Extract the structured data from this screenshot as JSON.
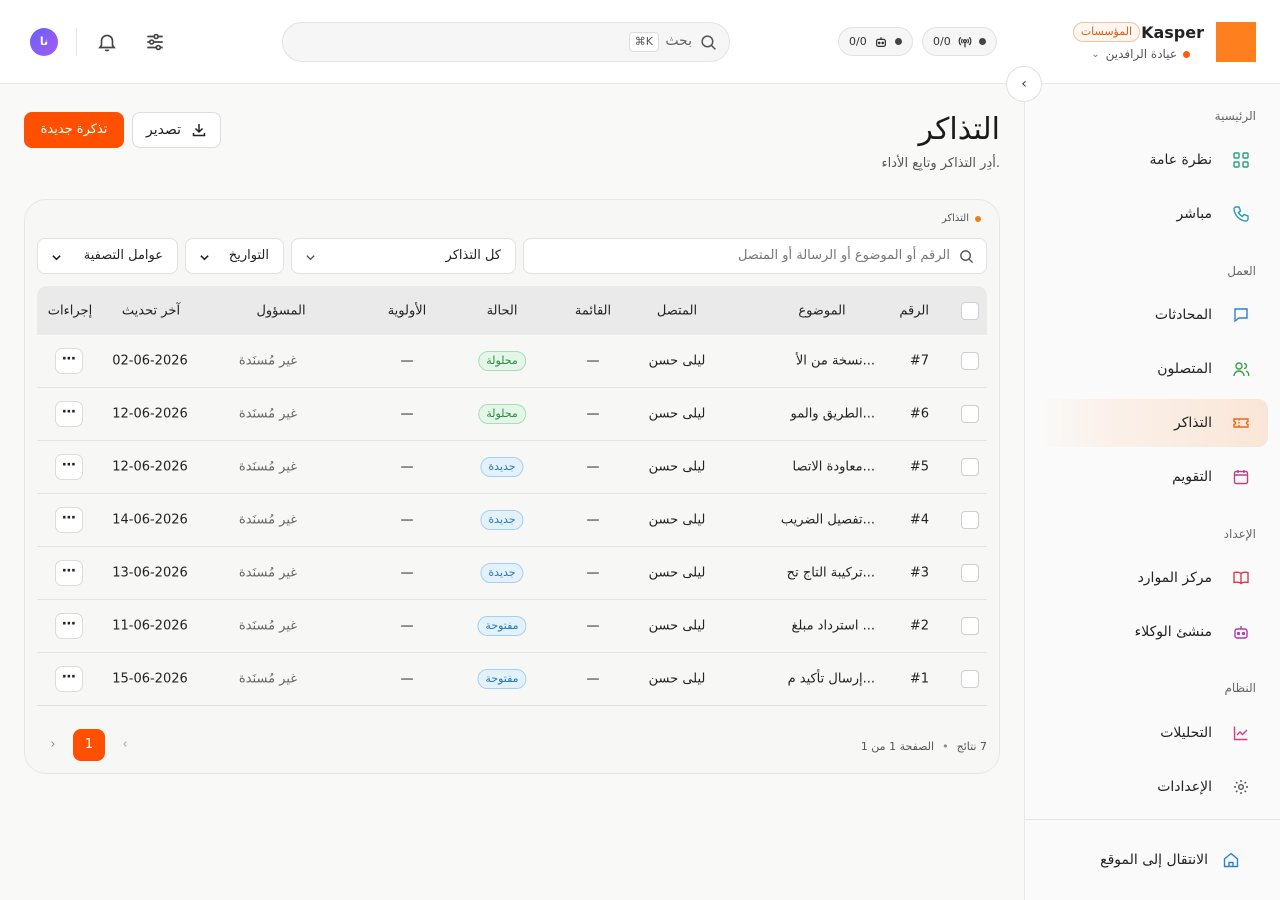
{
  "brand": {
    "name": "Kasper",
    "badge": "المؤسسات",
    "org": "عيادة الرافدين",
    "accent": "#fe5000"
  },
  "topbar": {
    "counter_calls": "0/0",
    "counter_bots": "0/0",
    "search_label": "بحث",
    "search_shortcut": "⌘K",
    "avatar_initials": "نا"
  },
  "sidebar": {
    "sections": [
      {
        "title": "الرئيسية"
      },
      {
        "title": "العمل"
      },
      {
        "title": "الإعداد"
      },
      {
        "title": "النظام"
      }
    ],
    "items": [
      {
        "label": "نظرة عامة",
        "icon": "grid-icon"
      },
      {
        "label": "مباشر",
        "icon": "phone-icon"
      },
      {
        "label": "المحادثات",
        "icon": "chat-icon"
      },
      {
        "label": "المتصلون",
        "icon": "users-icon"
      },
      {
        "label": "التذاكر",
        "icon": "ticket-icon",
        "active": true
      },
      {
        "label": "التقويم",
        "icon": "calendar-icon"
      },
      {
        "label": "مركز الموارد",
        "icon": "book-icon"
      },
      {
        "label": "منشئ الوكلاء",
        "icon": "robot-icon"
      },
      {
        "label": "التحليلات",
        "icon": "chart-icon"
      },
      {
        "label": "الإعدادات",
        "icon": "gear-icon"
      }
    ],
    "goto_site": "الانتقال إلى الموقع"
  },
  "page": {
    "title": "التذاكر",
    "subtitle": "أدِر التذاكر وتابِع الأداء.",
    "new_button": "تذكرة جديدة",
    "export_button": "تصدير"
  },
  "card": {
    "breadcrumb": "التذاكر",
    "search_placeholder": "الرقم أو الموضوع أو الرسالة أو المتصل",
    "queue_select": "كل التذاكر",
    "dates_select": "التواريخ",
    "filters_select": "عوامل التصفية"
  },
  "table": {
    "headers": {
      "number": "الرقم",
      "subject": "الموضوع",
      "contact": "المتصل",
      "queue": "القائمة",
      "status": "الحالة",
      "priority": "الأولوية",
      "owner": "المسؤول",
      "updated": "آخر تحديث",
      "actions": "إجراءات"
    },
    "rows": [
      {
        "number": "#7",
        "subject": "نسخة من الأ...",
        "contact": "ليلى حسن",
        "queue": "—",
        "status": "محلولة",
        "status_kind": "green",
        "priority": "—",
        "owner": "غير مُسنَدة",
        "updated": "02-06-2026"
      },
      {
        "number": "#6",
        "subject": "الطريق والمو...",
        "contact": "ليلى حسن",
        "queue": "—",
        "status": "محلولة",
        "status_kind": "green",
        "priority": "—",
        "owner": "غير مُسنَدة",
        "updated": "12-06-2026"
      },
      {
        "number": "#5",
        "subject": "معاودة الاتصا...",
        "contact": "ليلى حسن",
        "queue": "—",
        "status": "جديدة",
        "status_kind": "blue",
        "priority": "—",
        "owner": "غير مُسنَدة",
        "updated": "12-06-2026"
      },
      {
        "number": "#4",
        "subject": "تفصيل الضريب...",
        "contact": "ليلى حسن",
        "queue": "—",
        "status": "جديدة",
        "status_kind": "blue",
        "priority": "—",
        "owner": "غير مُسنَدة",
        "updated": "14-06-2026"
      },
      {
        "number": "#3",
        "subject": "تركيبة التاج تح...",
        "contact": "ليلى حسن",
        "queue": "—",
        "status": "جديدة",
        "status_kind": "blue",
        "priority": "—",
        "owner": "غير مُسنَدة",
        "updated": "13-06-2026"
      },
      {
        "number": "#2",
        "subject": "استرداد مبلغ ...",
        "contact": "ليلى حسن",
        "queue": "—",
        "status": "مفتوحة",
        "status_kind": "blue",
        "priority": "—",
        "owner": "غير مُسنَدة",
        "updated": "11-06-2026"
      },
      {
        "number": "#1",
        "subject": "إرسال تأكيد م...",
        "contact": "ليلى حسن",
        "queue": "—",
        "status": "مفتوحة",
        "status_kind": "blue",
        "priority": "—",
        "owner": "غير مُسنَدة",
        "updated": "15-06-2026"
      }
    ],
    "more_label": "⋯"
  },
  "pagination": {
    "results": "7 نتائج",
    "page_info": "الصفحة 1 من 1",
    "current": "1"
  }
}
